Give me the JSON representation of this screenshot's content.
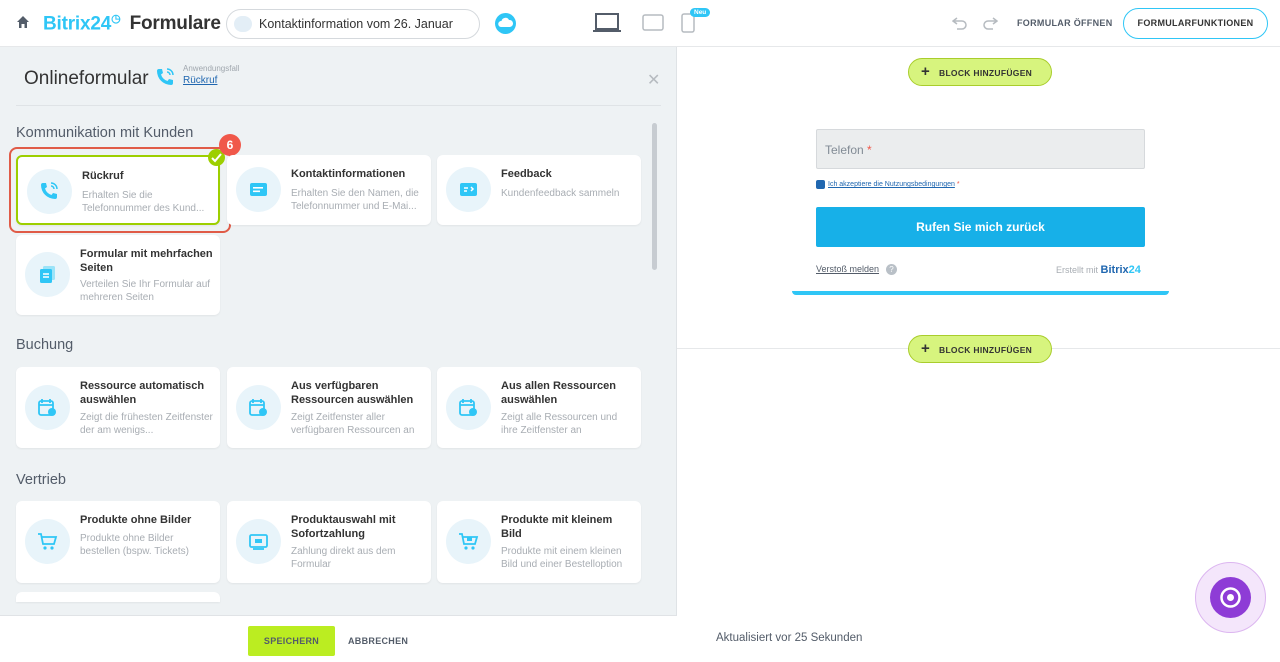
{
  "header": {
    "brand": "Bitrix24",
    "product_title": "Formulare",
    "form_name": "Kontaktinformation vom 26. Januar",
    "new_badge": "Neu",
    "open_form": "FORMULAR ÖFFNEN",
    "form_functions": "FORMULARFUNKTIONEN"
  },
  "panel": {
    "title": "Onlineformular",
    "use_case_label": "Anwendungsfall",
    "use_case_value": "Rückruf",
    "badge_count": "6",
    "sections": [
      {
        "title": "Kommunikation mit Kunden",
        "cards": [
          {
            "title": "Rückruf",
            "desc": "Erhalten Sie die Telefonnummer des Kund...",
            "selected": true
          },
          {
            "title": "Kontaktinformationen",
            "desc": "Erhalten Sie den Namen, die Telefonnummer und E-Mai..."
          },
          {
            "title": "Feedback",
            "desc": "Kundenfeedback sammeln"
          },
          {
            "title": "Formular mit mehrfachen Seiten",
            "desc": "Verteilen Sie Ihr Formular auf mehreren Seiten"
          }
        ]
      },
      {
        "title": "Buchung",
        "cards": [
          {
            "title": "Ressource automatisch auswählen",
            "desc": "Zeigt die frühesten Zeitfenster der am wenigs..."
          },
          {
            "title": "Aus verfügbaren Ressourcen auswählen",
            "desc": "Zeigt Zeitfenster aller verfügbaren Ressourcen an"
          },
          {
            "title": "Aus allen Ressourcen auswählen",
            "desc": "Zeigt alle Ressourcen und ihre Zeitfenster an"
          }
        ]
      },
      {
        "title": "Vertrieb",
        "cards": [
          {
            "title": "Produkte ohne Bilder",
            "desc": "Produkte ohne Bilder bestellen (bspw. Tickets)"
          },
          {
            "title": "Produktauswahl mit Sofortzahlung",
            "desc": "Zahlung direkt aus dem Formular"
          },
          {
            "title": "Produkte mit kleinem Bild",
            "desc": "Produkte mit einem kleinen Bild und einer Bestelloption"
          }
        ]
      }
    ],
    "save": "SPEICHERN",
    "cancel": "ABBRECHEN"
  },
  "preview": {
    "add_block": "BLOCK HINZUFÜGEN",
    "phone_label": "Telefon",
    "required_mark": "*",
    "agree_text": "Ich akzeptiere die Nutzungsbedingungen",
    "call_button": "Rufen Sie mich zurück",
    "report": "Verstoß melden",
    "help": "?",
    "made_with": "Erstellt mit",
    "made_brand": "Bitrix",
    "made_brand_num": "24",
    "updated": "Aktualisiert vor 25 Sekunden"
  },
  "colors": {
    "accent": "#2fc6f6",
    "selection": "#9dcf00",
    "badge": "#f0584a",
    "button_green": "#bbed21",
    "call_button": "#17b0e8"
  }
}
